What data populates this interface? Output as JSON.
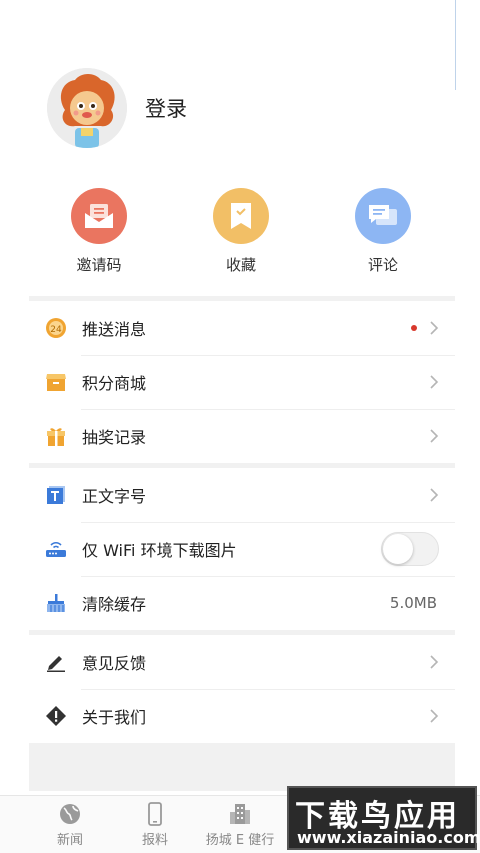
{
  "profile": {
    "login_label": "登录"
  },
  "quick_actions": [
    {
      "label": "邀请码",
      "icon": "envelope-icon",
      "color": "#ea7560"
    },
    {
      "label": "收藏",
      "icon": "bookmark-icon",
      "color": "#f2bf66"
    },
    {
      "label": "评论",
      "icon": "comment-icon",
      "color": "#8db6f3"
    }
  ],
  "menu": {
    "push": {
      "label": "推送消息",
      "icon": "push-24-icon",
      "has_dot": true
    },
    "points_mall": {
      "label": "积分商城",
      "icon": "shop-box-icon"
    },
    "lottery": {
      "label": "抽奖记录",
      "icon": "gift-icon"
    },
    "font_size": {
      "label": "正文字号",
      "icon": "text-size-icon"
    },
    "wifi_images": {
      "label": "仅 WiFi 环境下载图片",
      "icon": "router-icon",
      "toggle_on": false
    },
    "clear_cache": {
      "label": "清除缓存",
      "icon": "broom-icon",
      "value": "5.0MB"
    },
    "feedback": {
      "label": "意见反馈",
      "icon": "pencil-icon"
    },
    "about": {
      "label": "关于我们",
      "icon": "info-diamond-icon"
    }
  },
  "bottom_nav": [
    {
      "label": "新闻",
      "icon": "globe-icon"
    },
    {
      "label": "报料",
      "icon": "phone-icon"
    },
    {
      "label": "扬城 E 健行",
      "icon": "building-icon"
    }
  ],
  "watermark": {
    "title": "下载鸟应用",
    "url": "www.xiazainiao.com"
  },
  "colors": {
    "accent_red": "#d8382c",
    "icon_blue": "#3b7ad9",
    "icon_orange": "#f0a431"
  }
}
